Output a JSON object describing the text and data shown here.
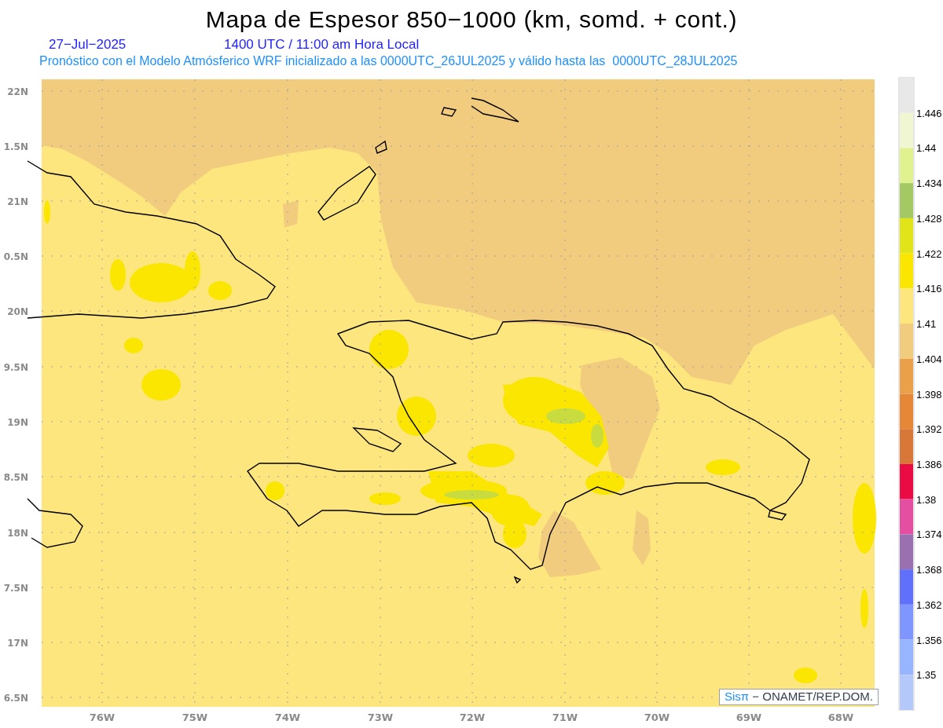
{
  "title": "Mapa de Espesor 850−1000 (km, somd. + cont.)",
  "date": "27−Jul−2025",
  "time": "1400 UTC / 11:00 am Hora Local",
  "subtitle": "Pronóstico con el Modelo Atmósferico WRF inicializado a las 0000UTC_26JUL2025 y válido hasta las  0000UTC_28JUL2025",
  "map": {
    "x_ticks": [
      "76W",
      "75W",
      "74W",
      "73W",
      "72W",
      "71W",
      "70W",
      "69W",
      "68W"
    ],
    "y_ticks": [
      "22N",
      "1.5N",
      "21N",
      "0.5N",
      "20N",
      "9.5N",
      "19N",
      "8.5N",
      "18N",
      "7.5N",
      "17N",
      "6.5N"
    ]
  },
  "legend": {
    "bins": [
      {
        "color": "#e8e8e8"
      },
      {
        "color": "#f0f6d2"
      },
      {
        "color": "#e0f290"
      },
      {
        "color": "#a4c864"
      },
      {
        "color": "#e0e418"
      },
      {
        "color": "#fae600"
      },
      {
        "color": "#fde67e"
      },
      {
        "color": "#f2cc7e"
      },
      {
        "color": "#eaa048"
      },
      {
        "color": "#e48838"
      },
      {
        "color": "#d87838"
      },
      {
        "color": "#ea0a44"
      },
      {
        "color": "#e44fa2"
      },
      {
        "color": "#9a70b0"
      },
      {
        "color": "#6070f8"
      },
      {
        "color": "#7f96ff"
      },
      {
        "color": "#96b4ff"
      },
      {
        "color": "#b4c8fa"
      }
    ],
    "labels": [
      "1.446",
      "1.44",
      "1.434",
      "1.428",
      "1.422",
      "1.416",
      "1.41",
      "1.404",
      "1.398",
      "1.392",
      "1.386",
      "1.38",
      "1.374",
      "1.368",
      "1.362",
      "1.356",
      "1.35"
    ]
  },
  "credit": {
    "brand": "Sisπ",
    "text": "− ONAMET/REP.DOM."
  }
}
